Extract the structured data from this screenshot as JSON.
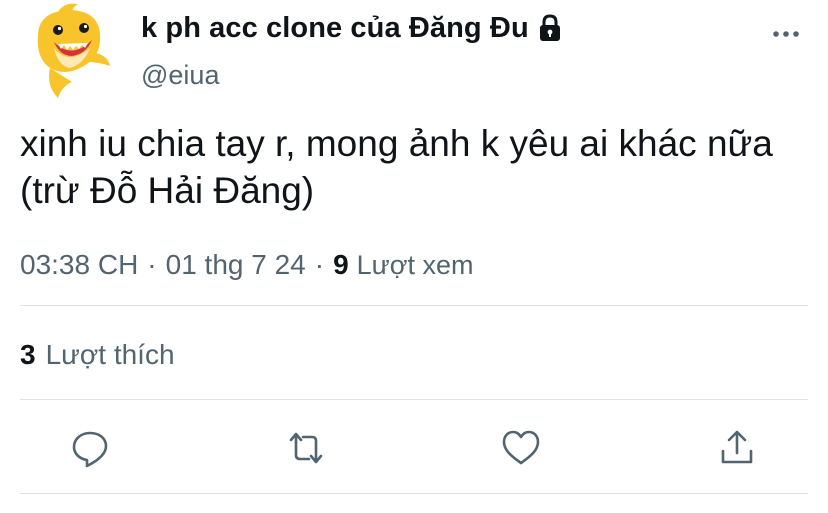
{
  "tweet": {
    "display_name": "k ph acc clone của Đăng Đu",
    "handle": "@eiua",
    "protected_icon": "lock-icon",
    "avatar": "baby-shark-avatar",
    "text": "xinh iu chia tay r, mong ảnh k yêu ai khác nữa (trừ Đỗ Hải Đăng)",
    "time": "03:38 CH",
    "separator": "·",
    "date": "01 thg 7 24",
    "views_count": "9",
    "views_label": "Lượt xem",
    "likes_count": "3",
    "likes_label": "Lượt thích"
  },
  "actions": [
    {
      "icon": "reply-icon",
      "label": "Reply"
    },
    {
      "icon": "retweet-icon",
      "label": "Retweet"
    },
    {
      "icon": "like-icon",
      "label": "Like"
    },
    {
      "icon": "share-icon",
      "label": "Share"
    }
  ],
  "colors": {
    "text_primary": "#0f1419",
    "text_secondary": "#536471",
    "divider": "#dfe3e6",
    "icon": "#536471",
    "avatar_yellow": "#f7c52b"
  }
}
